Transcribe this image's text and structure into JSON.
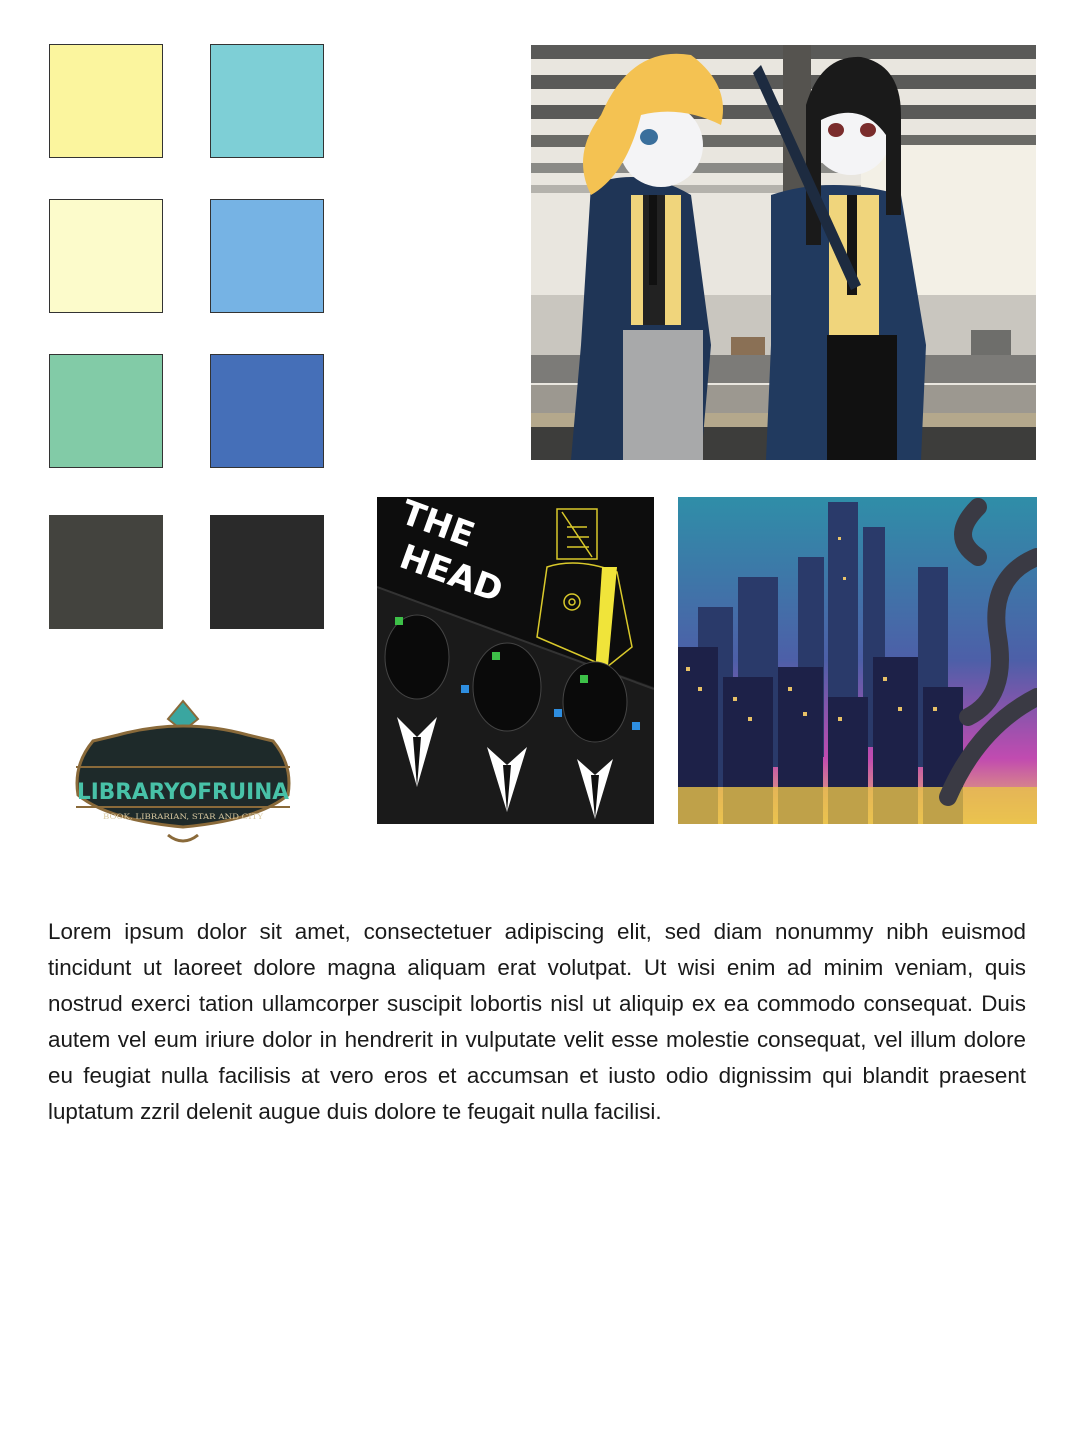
{
  "palette": {
    "swatches": [
      {
        "color": "#fbf59e"
      },
      {
        "color": "#7ecfd6"
      },
      {
        "color": "#fcfbcb"
      },
      {
        "color": "#76b3e4"
      },
      {
        "color": "#82cba7"
      },
      {
        "color": "#456fb8"
      },
      {
        "color": "#43433e"
      },
      {
        "color": "#2a2a2a"
      }
    ]
  },
  "artworks": {
    "head_poster": {
      "title_line1": "THE",
      "title_line2": "HEAD"
    },
    "logo": {
      "wordmark": "LIBRARYOFRUINA",
      "tagline": "BOOK, LIBRARIAN, STAR AND CITY"
    }
  },
  "body": {
    "paragraph": "Lorem ipsum dolor sit amet, consectetuer adipiscing elit, sed diam nonummy nibh euismod tincidunt ut laoreet dolore magna aliquam erat volutpat. Ut wisi enim ad minim veniam, quis nostrud exerci tation ullamcorper suscipit lobortis nisl ut aliquip ex ea commodo consequat. Duis autem vel eum iriure dolor in hendrerit in vulputate velit esse molestie consequat, vel illum dolore eu feugiat nulla facilisis at vero eros et accumsan et iusto odio dignissim qui blandit praesent luptatum zzril delenit augue duis dolore te feugait nulla facilisi."
  }
}
